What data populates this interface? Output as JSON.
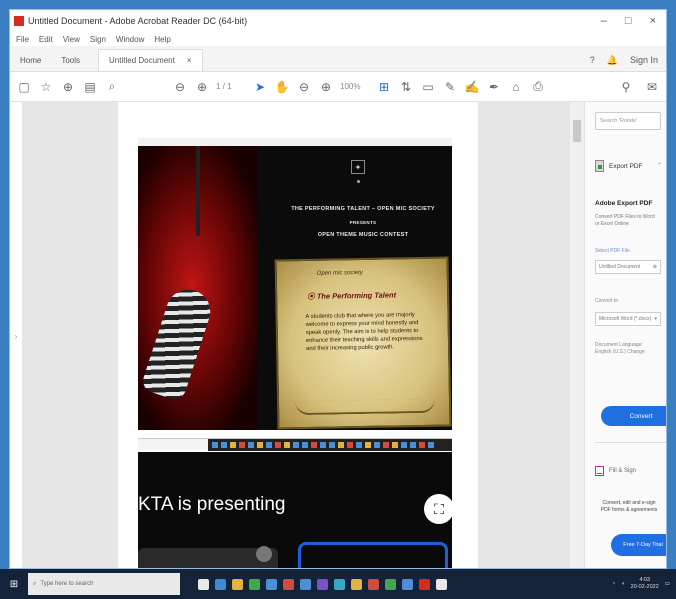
{
  "window": {
    "title": "Untitled Document - Adobe Acrobat Reader DC (64-bit)",
    "minimize_icon": "minimize-icon",
    "maximize_icon": "maximize-icon",
    "close_icon": "close-icon"
  },
  "menubar": {
    "items": [
      "File",
      "Edit",
      "View",
      "Sign",
      "Window",
      "Help"
    ]
  },
  "tabs": {
    "home": "Home",
    "tools": "Tools",
    "document": "Untitled Document",
    "document_close": "×",
    "help": "?",
    "bell": "🔔",
    "sign_in": "Sign In"
  },
  "toolbar": {
    "zoom_value": "100%",
    "page_indicator": "1 / 1"
  },
  "slide1": {
    "heading_line1": "THE PERFORMING TALENT – OPEN MIC SOCIETY",
    "heading_line2": "PRESENTS",
    "heading_line3": "OPEN THEME MUSIC CONTEST",
    "mic_caption": "",
    "intro": "Open mic society",
    "society_name": "The Performing Talent",
    "body": "A students club that where you are majorly welcome to express your mind honestly and speak openly. The aim is to help students to enhance their teaching skills and expressions and their increasing public growth."
  },
  "slide2": {
    "presenting": "KTA is presenting",
    "fullscreen_icon": "fullscreen-icon"
  },
  "panel": {
    "search_placeholder": "Search 'Rotate'",
    "export_label": "Export PDF",
    "export_chevron": "⌃",
    "heading": "Adobe Export PDF",
    "description": "Convert PDF Files to Word or Excel Online",
    "select_pdf_label": "Select PDF File",
    "select_pdf_value": "Untitled Document",
    "convert_to_label": "Convert to",
    "convert_to_value": "Microsoft Word (*.docx)",
    "language_text": "Document Language: English (U.S.) Change",
    "convert_button": "Convert",
    "fill_sign": "Fill & Sign",
    "promo": "Convert, edit and e-sign PDF forms & agreements",
    "trial_button": "Free 7-Day Trial"
  },
  "taskbar": {
    "search_placeholder": "Type here to search",
    "time": "4:03",
    "date": "20-02-2022",
    "app_colors": [
      "#e8e8e8",
      "#3e8ad6",
      "#e3b341",
      "#3fa84a",
      "#4a8fd8",
      "#d14c3d",
      "#4a8fd8",
      "#7a52c7",
      "#3aa6c7",
      "#e3b341",
      "#d14c3d",
      "#3fa84a",
      "#4a8fd8",
      "#d62b1f",
      "#e8e8e8"
    ]
  }
}
